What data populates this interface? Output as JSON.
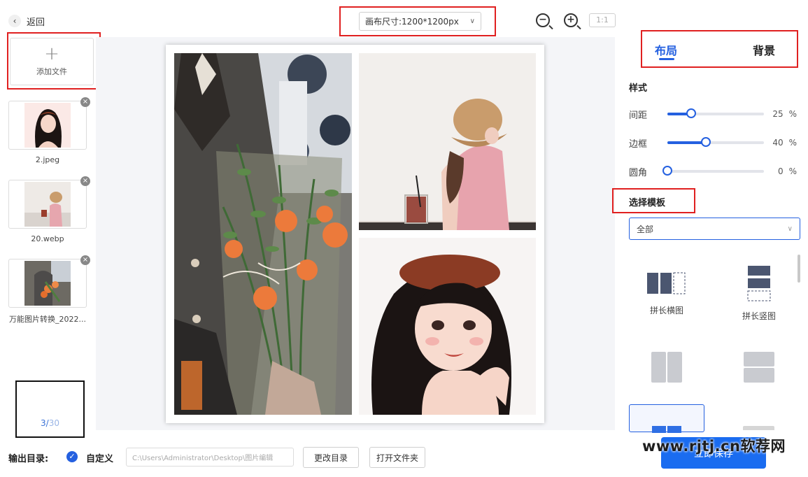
{
  "top": {
    "back_label": "返回",
    "canvas_size": "画布尺寸:1200*1200px",
    "ratio_label": "1:1"
  },
  "left": {
    "add_file_label": "添加文件",
    "files": [
      {
        "name": "2.jpeg"
      },
      {
        "name": "20.webp"
      },
      {
        "name": "万能图片转换_2022..."
      }
    ],
    "count_current": "3",
    "count_sep": "/",
    "count_total": "30"
  },
  "right": {
    "tabs": [
      {
        "label": "布局"
      },
      {
        "label": "背景"
      }
    ],
    "style_title": "样式",
    "sliders": [
      {
        "label": "间距",
        "value": "25",
        "unit": "%",
        "fraction": 0.25
      },
      {
        "label": "边框",
        "value": "40",
        "unit": "%",
        "fraction": 0.4
      },
      {
        "label": "圆角",
        "value": "0",
        "unit": "%",
        "fraction": 0.0
      }
    ],
    "template_title": "选择模板",
    "template_filter": "全部",
    "templates": [
      {
        "label": "拼长横图"
      },
      {
        "label": "拼长竖图"
      }
    ]
  },
  "bottom": {
    "output_label": "输出目录:",
    "custom_label": "自定义",
    "path_value": "C:\\Users\\Administrator\\Desktop\\图片编辑",
    "change_dir": "更改目录",
    "open_folder": "打开文件夹",
    "save_now": "立即保存"
  },
  "watermark": "www.rjtj.cn软荐网",
  "colors": {
    "accent": "#2460e0",
    "highlight_box": "#e02020",
    "save_button": "#1a6cf0"
  }
}
